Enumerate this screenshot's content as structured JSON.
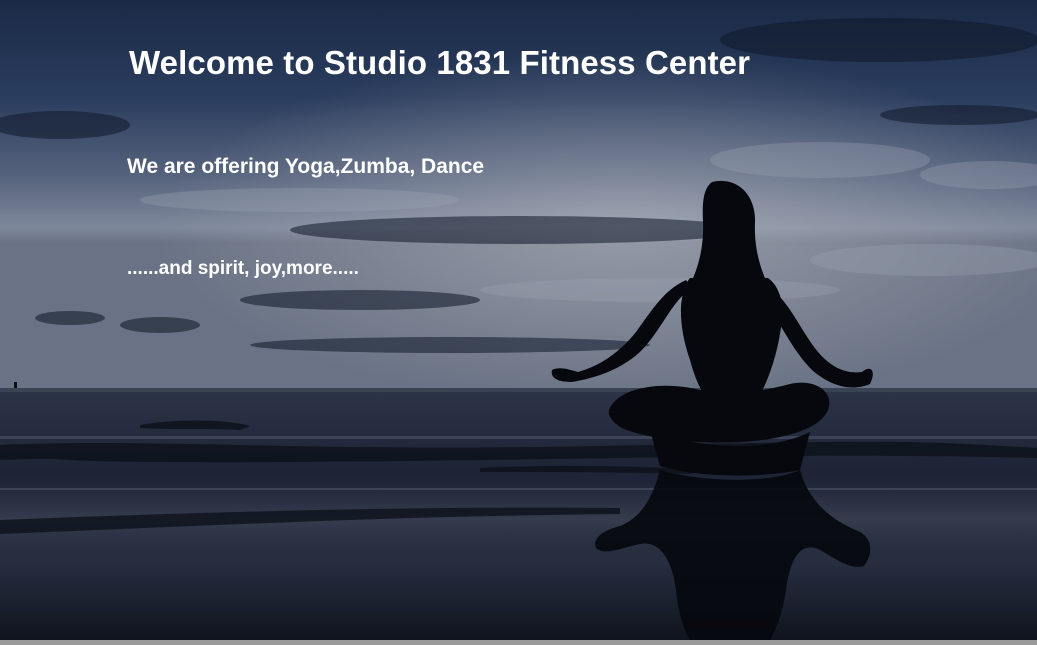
{
  "hero": {
    "headline": "Welcome to Studio 1831 Fitness Center",
    "offering": "We are offering Yoga,Zumba, Dance",
    "tagline": "......and spirit, joy,more.....",
    "image": "meditating-silhouette-on-beach-at-dusk"
  },
  "colors": {
    "sky_top": "#1e2f4f",
    "sky_glow": "#8e98a8",
    "sea": "#1a2030",
    "silhouette": "#07090e",
    "text": "#ffffff",
    "page_background": "#9a9a9a"
  }
}
